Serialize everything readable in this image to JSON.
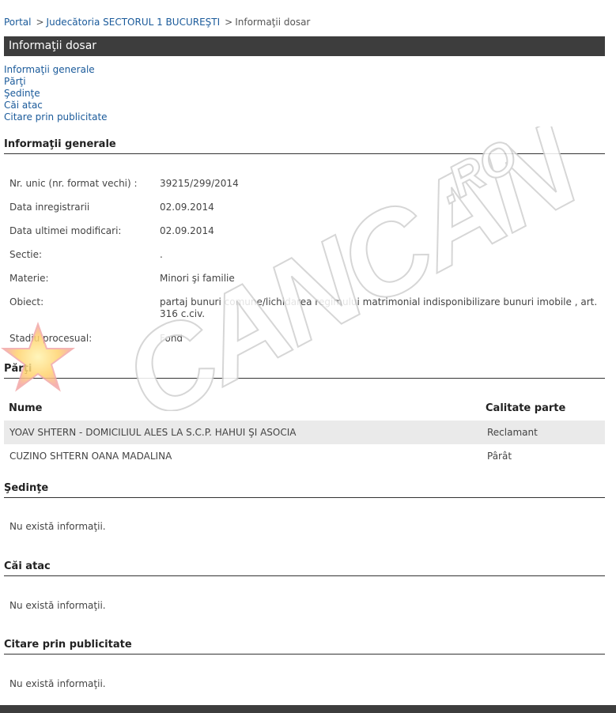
{
  "breadcrumb": {
    "portal": "Portal",
    "sep1": ">",
    "court": "Judecătoria SECTORUL 1 BUCUREŞTI",
    "sep2": ">",
    "current": "Informaţii dosar"
  },
  "title": "Informaţii dosar",
  "toc": [
    "Informaţii generale",
    "Părţi",
    "Şedinţe",
    "Căi atac",
    "Citare prin publicitate"
  ],
  "general": {
    "heading": "Informaţii generale",
    "rows": [
      {
        "label": "Nr. unic (nr. format vechi) :",
        "value": "39215/299/2014"
      },
      {
        "label": "Data inregistrarii",
        "value": "02.09.2014"
      },
      {
        "label": "Data ultimei modificari:",
        "value": "02.09.2014"
      },
      {
        "label": "Sectie:",
        "value": "."
      },
      {
        "label": "Materie:",
        "value": "Minori şi familie"
      },
      {
        "label": "Obiect:",
        "value": "partaj bunuri comune/lichidarea regimului matrimonial indisponibilizare bunuri imobile , art. 316 c.civ."
      },
      {
        "label": "Stadiu procesual:",
        "value": "Fond"
      }
    ]
  },
  "parti": {
    "heading": "Părţi",
    "col_name": "Nume",
    "col_role": "Calitate parte",
    "rows": [
      {
        "name": "YOAV SHTERN - DOMICILIUL ALES LA S.C.P. HAHUI ŞI ASOCIA",
        "role": "Reclamant"
      },
      {
        "name": "CUZINO SHTERN OANA MADALINA",
        "role": "Pârât"
      }
    ]
  },
  "sedinte": {
    "heading": "Şedinţe",
    "empty": "Nu există informaţii."
  },
  "cai_atac": {
    "heading": "Căi atac",
    "empty": "Nu există informaţii."
  },
  "citare": {
    "heading": "Citare prin publicitate",
    "empty": "Nu există informaţii."
  },
  "watermark": {
    "text": "CANCAN",
    "suffix": ".RO"
  }
}
